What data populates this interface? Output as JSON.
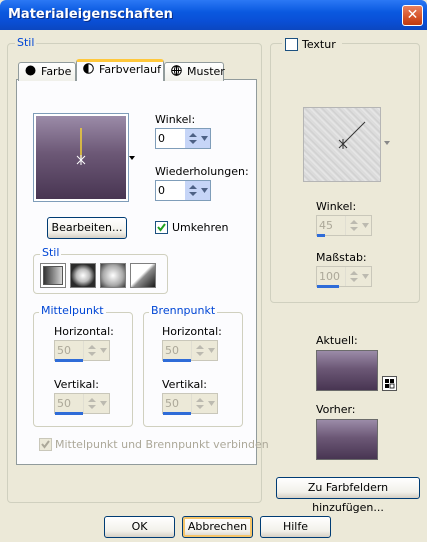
{
  "window": {
    "title": "Materialeigenschaften",
    "close_symbol": "✕"
  },
  "stil": {
    "legend": "Stil",
    "tabs": [
      {
        "label": "Farbe",
        "icon": "circle-icon"
      },
      {
        "label": "Farbverlauf",
        "icon": "half-circle-icon",
        "active": true
      },
      {
        "label": "Muster",
        "icon": "globe-icon"
      }
    ],
    "preview_dropdown": "dropdown-arrow-icon",
    "winkel_label": "Winkel:",
    "winkel_value": "0",
    "wiederholungen_label": "Wiederholungen:",
    "wiederholungen_value": "0",
    "edit_button": "Bearbeiten...",
    "umkehren_label": "Umkehren",
    "umkehren_checked": true,
    "style_group_legend": "Stil",
    "mittelpunkt": {
      "legend": "Mittelpunkt",
      "horizontal_label": "Horizontal:",
      "horizontal_value": "50",
      "vertikal_label": "Vertikal:",
      "vertikal_value": "50"
    },
    "brennpunkt": {
      "legend": "Brennpunkt",
      "horizontal_label": "Horizontal:",
      "horizontal_value": "50",
      "vertikal_label": "Vertikal:",
      "vertikal_value": "50"
    },
    "link_label": "Mittelpunkt und Brennpunkt verbinden"
  },
  "textur": {
    "label": "Textur",
    "checked": false,
    "winkel_label": "Winkel:",
    "winkel_value": "45",
    "massstab_label": "Maßstab:",
    "massstab_value": "100"
  },
  "aktuell_label": "Aktuell:",
  "vorher_label": "Vorher:",
  "add_swatches_button": "Zu Farbfeldern hinzufügen...",
  "buttons": {
    "ok": "OK",
    "cancel": "Abbrechen",
    "help": "Hilfe"
  },
  "colors": {
    "accent": "#0046d5",
    "swatch_top": "#9b8ba8",
    "swatch_bottom": "#483552"
  }
}
